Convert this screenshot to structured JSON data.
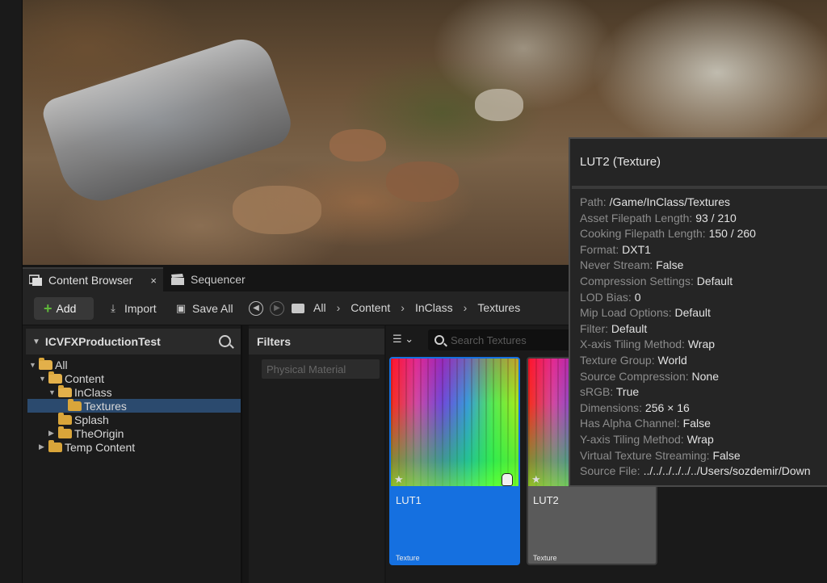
{
  "tabs": {
    "content_browser": "Content Browser",
    "content_browser_close": "×",
    "sequencer": "Sequencer"
  },
  "toolbar": {
    "add_label": "Add",
    "import_label": "Import",
    "save_all_label": "Save All"
  },
  "breadcrumb": [
    "All",
    "Content",
    "InClass",
    "Textures"
  ],
  "tree": {
    "root_label": "ICVFXProductionTest",
    "items": [
      {
        "label": "All"
      },
      {
        "label": "Content"
      },
      {
        "label": "InClass"
      },
      {
        "label": "Textures"
      },
      {
        "label": "Splash"
      },
      {
        "label": "TheOrigin"
      },
      {
        "label": "Temp Content"
      }
    ]
  },
  "filters": {
    "header": "Filters",
    "items": [
      "Physical Material"
    ]
  },
  "search": {
    "placeholder": "Search Textures"
  },
  "assets": [
    {
      "name": "LUT1",
      "type": "Texture",
      "selected": true
    },
    {
      "name": "LUT2",
      "type": "Texture",
      "selected": false
    }
  ],
  "tooltip": {
    "title": "LUT2 (Texture)",
    "rows": [
      {
        "key": "Path:",
        "value": "/Game/InClass/Textures"
      },
      {
        "key": "Asset Filepath Length:",
        "value": "93 / 210"
      },
      {
        "key": "Cooking Filepath Length:",
        "value": "150 / 260"
      },
      {
        "key": "Format:",
        "value": "DXT1"
      },
      {
        "key": "Never Stream:",
        "value": "False"
      },
      {
        "key": "Compression Settings:",
        "value": "Default"
      },
      {
        "key": "LOD Bias:",
        "value": "0"
      },
      {
        "key": "Mip Load Options:",
        "value": "Default"
      },
      {
        "key": "Filter:",
        "value": "Default"
      },
      {
        "key": "X-axis Tiling Method:",
        "value": "Wrap"
      },
      {
        "key": "Texture Group:",
        "value": "World"
      },
      {
        "key": "Source Compression:",
        "value": "None"
      },
      {
        "key": "sRGB:",
        "value": "True"
      },
      {
        "key": "Dimensions:",
        "value": "256 × 16"
      },
      {
        "key": "Has Alpha Channel:",
        "value": "False"
      },
      {
        "key": "Y-axis Tiling Method:",
        "value": "Wrap"
      },
      {
        "key": "Virtual Texture Streaming:",
        "value": "False"
      },
      {
        "key": "Source File:",
        "value": "../../../../../../Users/sozdemir/Down"
      }
    ]
  },
  "colors": {
    "selection_blue": "#1570e0",
    "add_plus_green": "#5fb83a",
    "folder_yellow": "#d9a53a"
  }
}
